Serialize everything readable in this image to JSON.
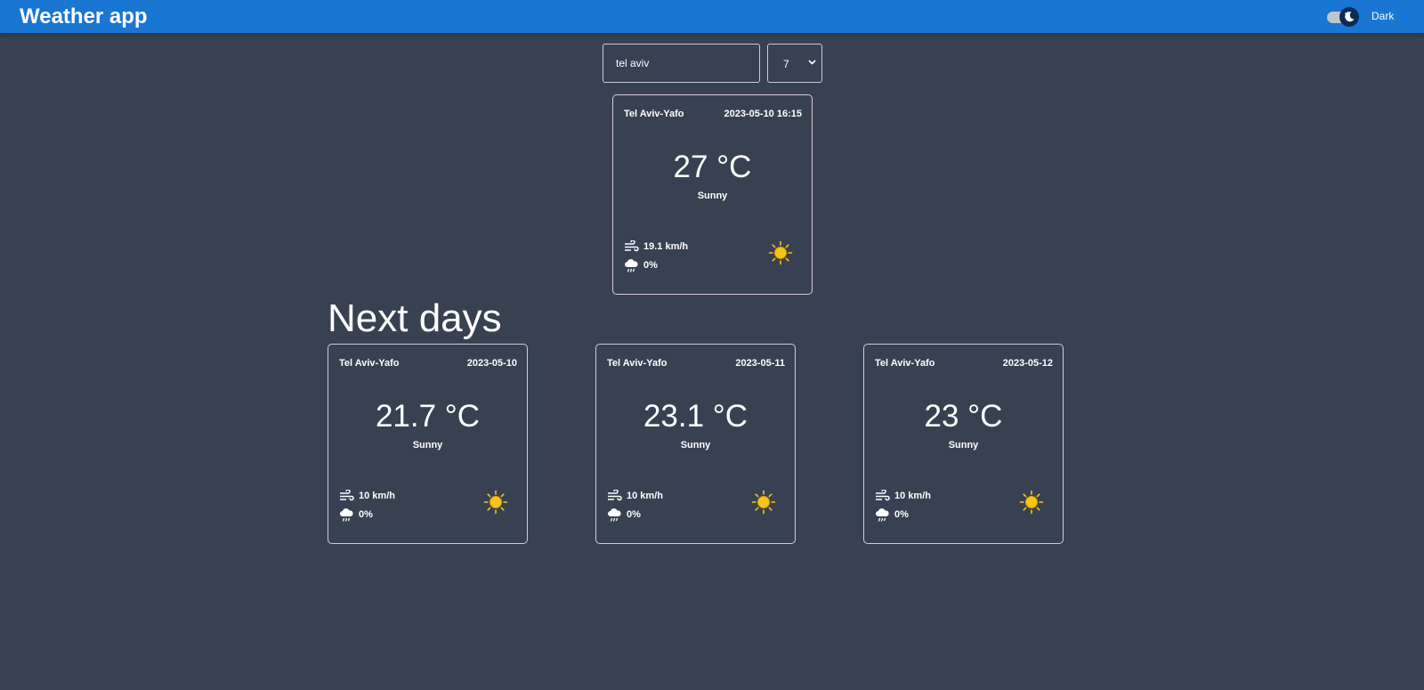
{
  "header": {
    "title": "Weather app",
    "theme_label": "Dark"
  },
  "search": {
    "value": "tel aviv",
    "days_value": "7"
  },
  "current": {
    "city": "Tel Aviv-Yafo",
    "datetime": "2023-05-10 16:15",
    "temperature": "27 °C",
    "condition": "Sunny",
    "wind": "19.1 km/h",
    "rain": "0%"
  },
  "forecast": {
    "title": "Next days",
    "days": [
      {
        "city": "Tel Aviv-Yafo",
        "date": "2023-05-10",
        "temperature": "21.7 °C",
        "condition": "Sunny",
        "wind": "10 km/h",
        "rain": "0%"
      },
      {
        "city": "Tel Aviv-Yafo",
        "date": "2023-05-11",
        "temperature": "23.1 °C",
        "condition": "Sunny",
        "wind": "10 km/h",
        "rain": "0%"
      },
      {
        "city": "Tel Aviv-Yafo",
        "date": "2023-05-12",
        "temperature": "23 °C",
        "condition": "Sunny",
        "wind": "10 km/h",
        "rain": "0%"
      }
    ]
  },
  "colors": {
    "appbar": "#1976d2",
    "background": "#374151",
    "card_border": "#d9c8d8",
    "sun": "#f5c518"
  },
  "icons": {
    "wind": "wind-icon",
    "rain": "rain-cloud-icon",
    "weather": "sun-icon",
    "theme": "moon-icon"
  }
}
